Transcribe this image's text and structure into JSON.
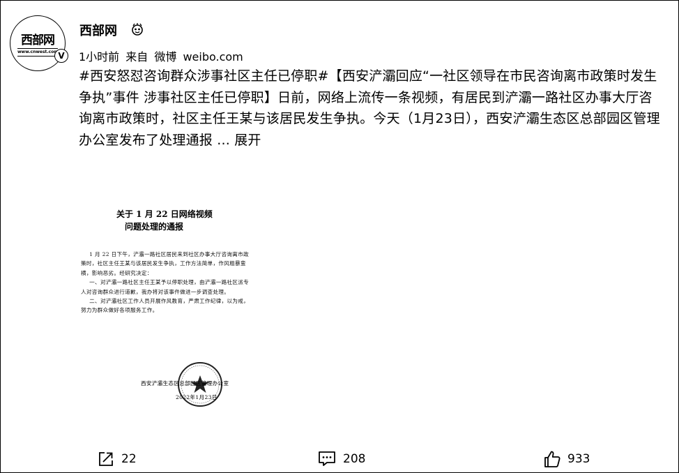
{
  "user": {
    "avatar_text": "西部网",
    "avatar_sub": "www.cnwest.com",
    "verified_mark": "V",
    "name": "西部网"
  },
  "meta": {
    "time": "1小时前",
    "source": "来自 微博 weibo.com"
  },
  "post": {
    "text": "#西安怒怼咨询群众涉事社区主任已停职#【西安浐灞回应“一社区领导在市民咨询离市政策时发生争执”事件 涉事社区主任已停职】日前，网络上流传一条视频，有居民到浐灞一路社区办事大厅咨询离市政策时，社区主任王某与该居民发生争执。今天（1月23日），西安浐灞生态区总部园区管理办公室发布了处理通报 ",
    "expand_label": "... 展开"
  },
  "document": {
    "title_line1": "关于 1 月 22 日网络视频",
    "title_line2": "问题处理的通报",
    "para1": "1 月 22 日下午，浐灞一路社区居民来到社区办事大厅咨询离市政策时，社区主任王某与该居民发生争执，工作方法简单，作风粗暴蛮横，影响恶劣。经研究决定：",
    "para2": "一、对浐灞一路社区主任王某予以停职处理，由浐灞一路社区派专人对咨询群众进行道歉，我办将对该事件做进一步调查处理。",
    "para3": "二、对浐灞社区工作人员开展作风教育，严肃工作纪律，以为戒，努力为群众做好各项服务工作。",
    "signature": "西安浐灞生态区总部园区管理办公室",
    "date": "2022年1月23日"
  },
  "actions": {
    "share_count": "22",
    "comment_count": "208",
    "like_count": "933"
  },
  "icons": {
    "share": "share-icon",
    "comment": "comment-icon",
    "like": "thumbs-up-icon",
    "user_badge": "user-badge-icon"
  }
}
